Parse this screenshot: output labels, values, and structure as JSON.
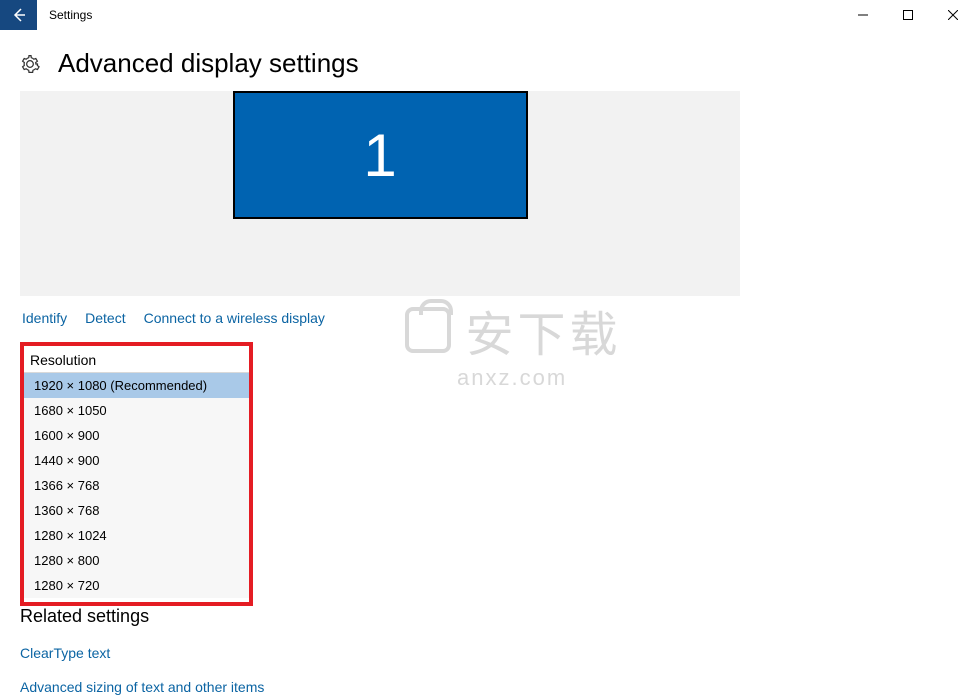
{
  "window": {
    "title": "Settings"
  },
  "page": {
    "heading": "Advanced display settings",
    "monitor_number": "1"
  },
  "links": {
    "identify": "Identify",
    "detect": "Detect",
    "connect_wireless": "Connect to a wireless display"
  },
  "resolution": {
    "label": "Resolution",
    "options": [
      "1920 × 1080 (Recommended)",
      "1680 × 1050",
      "1600 × 900",
      "1440 × 900",
      "1366 × 768",
      "1360 × 768",
      "1280 × 1024",
      "1280 × 800",
      "1280 × 720"
    ],
    "selected_index": 0
  },
  "related": {
    "heading": "Related settings",
    "cleartype": "ClearType text",
    "advanced_sizing": "Advanced sizing of text and other items"
  },
  "watermark": {
    "cn": "安下载",
    "en": "anxz.com"
  }
}
